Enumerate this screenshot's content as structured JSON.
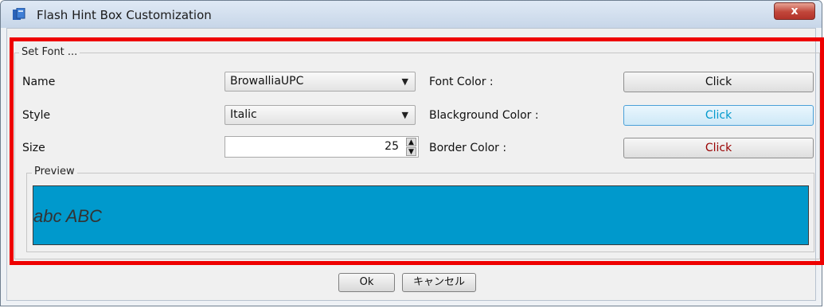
{
  "window": {
    "title": "Flash Hint Box Customization",
    "close_glyph": "x"
  },
  "font_group": {
    "legend": "Set Font ...",
    "name_label": "Name",
    "name_value": "BrowalliaUPC",
    "style_label": "Style",
    "style_value": "Italic",
    "size_label": "Size",
    "size_value": "25",
    "font_color_label": "Font Color :",
    "font_color_button": "Click",
    "background_color_label": "Blackground Color :",
    "background_color_button": "Click",
    "border_color_label": "Border Color :",
    "border_color_button": "Click"
  },
  "preview": {
    "legend": "Preview",
    "text": "abc ABC",
    "background_color": "#0099CC",
    "text_color": "#333333"
  },
  "footer": {
    "ok_label": "Ok",
    "cancel_label": "キャンセル"
  },
  "colors": {
    "font_color_button_text": "#111111",
    "background_color_button_text": "#0099CC",
    "border_color_button_text": "#990000",
    "highlight": "#EE0000"
  },
  "icons": {
    "app": "book-icon",
    "close": "close-icon",
    "dropdown": "chevron-down-icon",
    "spin_up": "spin-up-icon",
    "spin_down": "spin-down-icon"
  }
}
